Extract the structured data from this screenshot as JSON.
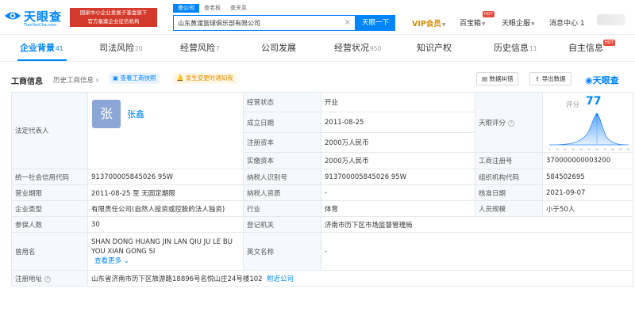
{
  "brand": {
    "name": "天眼查",
    "sub": "TianYanCha.com",
    "color": "#0084ff"
  },
  "promo": {
    "line1": "国家中小企业发展子基金旗下",
    "line2": "官方备案企业征信机构"
  },
  "search": {
    "tabs": [
      "查公司",
      "查老板",
      "查关系"
    ],
    "value": "山东黄渡篮球俱乐部有限公司",
    "button": "天眼一下"
  },
  "nav": {
    "vip": "VIP会员",
    "baibao": "百宝箱",
    "hot": "HOT",
    "enterprise": "天眼企服",
    "messages": "消息中心 1"
  },
  "tabs": [
    {
      "label": "企业背景",
      "count": "41"
    },
    {
      "label": "司法风险",
      "count": "20"
    },
    {
      "label": "经营风险",
      "count": "7"
    },
    {
      "label": "公司发展",
      "count": ""
    },
    {
      "label": "经营状况",
      "count": "950"
    },
    {
      "label": "知识产权",
      "count": ""
    },
    {
      "label": "历史信息",
      "count": "11"
    },
    {
      "label": "自主信息",
      "count": ""
    }
  ],
  "section": {
    "title": "工商信息",
    "history": "历史工商信息",
    "snapshot": "查看工商快照",
    "changes": "发生变更时通知我",
    "download": "数据纠错",
    "export": "导出数据",
    "brand": "天眼查"
  },
  "info": {
    "legal_rep_label": "法定代表人",
    "legal_rep_avatar": "张",
    "legal_rep_name": "张鑫",
    "status_label": "经营状态",
    "status": "开业",
    "founded_label": "成立日期",
    "founded": "2011-08-25",
    "capital_label": "注册资本",
    "capital": "2000万人民币",
    "paid_label": "实缴资本",
    "paid": "2000万人民币",
    "score_label": "天眼评分",
    "score_title": "评分",
    "score": "77",
    "reg_no_label": "工商注册号",
    "reg_no": "370000000003200",
    "credit_label": "统一社会信用代码",
    "credit": "913700005845026 95W",
    "taxpayer_label": "纳税人识别号",
    "taxpayer": "913700005845026 95W",
    "org_label": "组织机构代码",
    "org": "584502695",
    "term_label": "营业期限",
    "term": "2011-08-25  至  无固定期限",
    "qual_label": "纳税人资质",
    "qual": "-",
    "approve_label": "核准日期",
    "approve": "2021-09-07",
    "type_label": "企业类型",
    "type": "有限责任公司(自然人投资或控股的法人独资)",
    "industry_label": "行业",
    "industry": "体育",
    "staff_label": "人员规模",
    "staff": "小于50人",
    "insured_label": "参保人数",
    "insured": "30",
    "authority_label": "登记机关",
    "authority": "济南市历下区市场监督管理局",
    "former_label": "曾用名",
    "former": "SHAN DONG HUANG JIN LAN QIU JU LE BU YOU XIAN GONG SI",
    "former_more": "查看更多",
    "en_label": "英文名称",
    "en": "-",
    "address_label": "注册地址",
    "address": "山东省济南市历下区旅游路18896号名悦山庄24号楼102",
    "nearby": "附近公司"
  },
  "score_chart": {
    "type": "area",
    "x_ticks": [
      "0",
      "10",
      "20",
      "30",
      "40",
      "50",
      "60",
      "70",
      "80",
      "90",
      "100"
    ],
    "marker": 77
  }
}
